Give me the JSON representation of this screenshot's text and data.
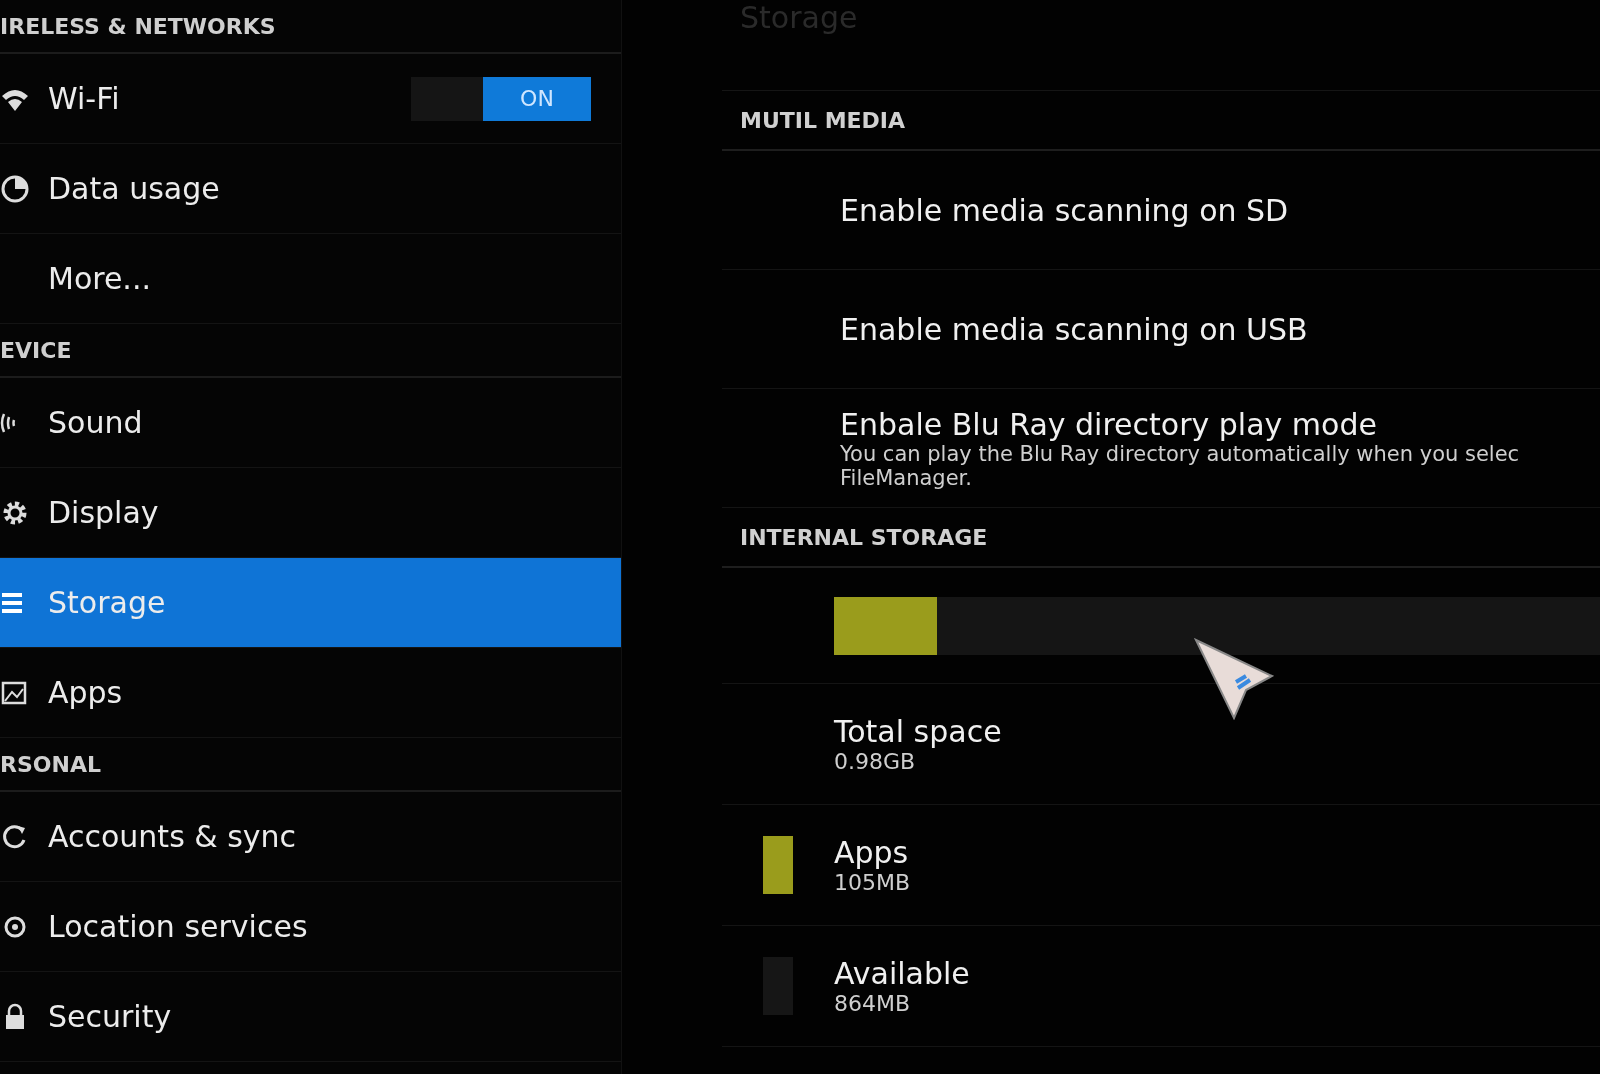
{
  "sidebar": {
    "sections": [
      {
        "header": "IRELESS & NETWORKS",
        "items": [
          {
            "label": "Wi-Fi",
            "kind": "wifi",
            "selected": false,
            "toggle": {
              "label": "ON",
              "on": true
            }
          },
          {
            "label": "Data usage",
            "kind": "pie",
            "selected": false
          },
          {
            "label": "More...",
            "kind": "plain",
            "selected": false
          }
        ]
      },
      {
        "header": "EVICE",
        "items": [
          {
            "label": "Sound",
            "kind": "speaker",
            "selected": false
          },
          {
            "label": "Display",
            "kind": "gear",
            "selected": false
          },
          {
            "label": "Storage",
            "kind": "bars",
            "selected": true
          },
          {
            "label": "Apps",
            "kind": "picture",
            "selected": false
          }
        ]
      },
      {
        "header": "RSONAL",
        "items": [
          {
            "label": "Accounts & sync",
            "kind": "sync",
            "selected": false
          },
          {
            "label": "Location services",
            "kind": "eye",
            "selected": false
          },
          {
            "label": "Security",
            "kind": "lock",
            "selected": false
          }
        ]
      }
    ]
  },
  "content": {
    "title": "Storage",
    "sections": [
      {
        "header": "MUTIL MEDIA",
        "kind": "prefs",
        "items": [
          {
            "title": "Enable media scanning on SD"
          },
          {
            "title": "Enable media scanning on USB"
          },
          {
            "title": "Enbale Blu Ray directory play mode",
            "summary": "You can play the Blu Ray directory automatically when you selec FileManager."
          }
        ]
      },
      {
        "header": "INTERNAL STORAGE",
        "kind": "storage",
        "bar": {
          "level": 0.135,
          "color": "#9a9c1c"
        },
        "items": [
          {
            "title": "Total space",
            "value": "0.98GB"
          },
          {
            "title": "Apps",
            "value": "105MB",
            "color": "#9a9c1c"
          },
          {
            "title": "Available",
            "value": "864MB",
            "color": "#161616"
          }
        ]
      }
    ]
  }
}
